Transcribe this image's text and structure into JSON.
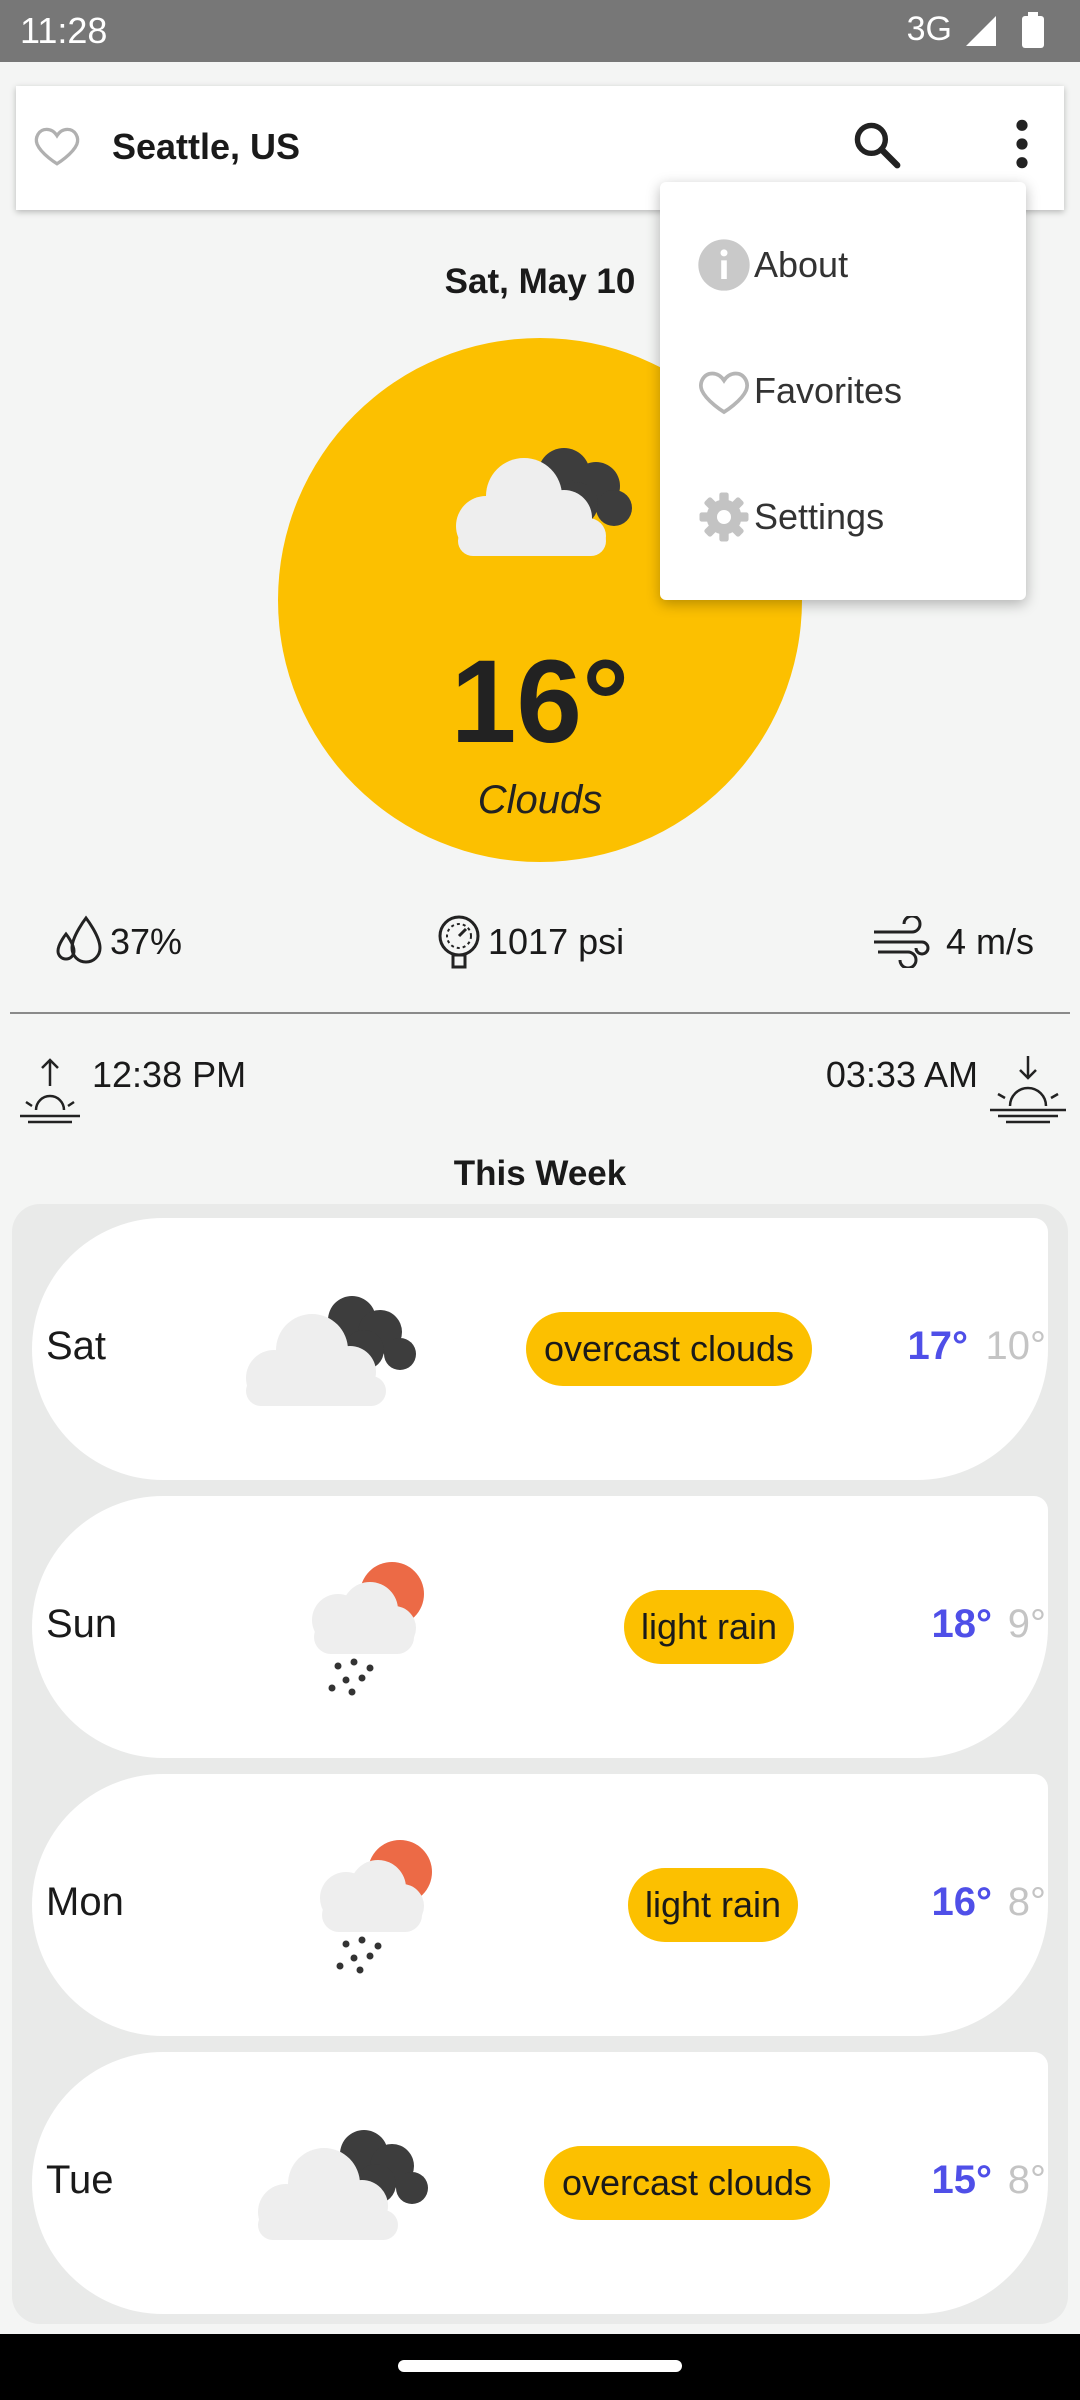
{
  "status_bar": {
    "time": "11:28",
    "network": "3G"
  },
  "app_bar": {
    "title": "Seattle, US"
  },
  "menu": {
    "items": [
      "About",
      "Favorites",
      "Settings"
    ]
  },
  "current": {
    "date": "Sat, May 10",
    "temp": "16°",
    "condition": "Clouds",
    "humidity": "37%",
    "pressure": "1017 psi",
    "wind": "4 m/s",
    "sunrise": "12:38 PM",
    "sunset": "03:33 AM"
  },
  "week": {
    "title": "This Week",
    "days": [
      {
        "day": "Sat",
        "desc": "overcast clouds",
        "hi": "17°",
        "lo": "10°",
        "icon": "overcast-cloud-icon"
      },
      {
        "day": "Sun",
        "desc": "light rain",
        "hi": "18°",
        "lo": "9°",
        "icon": "rain-sun-icon"
      },
      {
        "day": "Mon",
        "desc": "light rain",
        "hi": "16°",
        "lo": "8°",
        "icon": "rain-sun-icon"
      },
      {
        "day": "Tue",
        "desc": "overcast clouds",
        "hi": "15°",
        "lo": "8°",
        "icon": "overcast-cloud-icon"
      }
    ]
  },
  "colors": {
    "accent": "#fcc000",
    "high_temp": "#4f4fe8",
    "low_temp": "#c4c4c4"
  }
}
